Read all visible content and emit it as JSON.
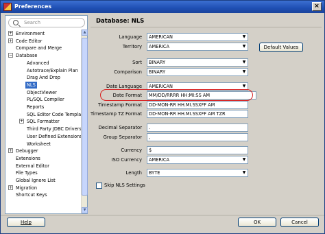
{
  "window": {
    "title": "Preferences",
    "close_glyph": "×"
  },
  "search": {
    "placeholder": "Search"
  },
  "tree": [
    {
      "label": "Environment",
      "toggle": "+",
      "level": 0
    },
    {
      "label": "Code Editor",
      "toggle": "+",
      "level": 0
    },
    {
      "label": "Compare and Merge",
      "toggle": "",
      "level": 0
    },
    {
      "label": "Database",
      "toggle": "−",
      "level": 0
    },
    {
      "label": "Advanced",
      "toggle": "",
      "level": 1
    },
    {
      "label": "Autotrace/Explain Plan",
      "toggle": "",
      "level": 1
    },
    {
      "label": "Drag And Drop",
      "toggle": "",
      "level": 1
    },
    {
      "label": "NLS",
      "toggle": "",
      "level": 1,
      "selected": true
    },
    {
      "label": "ObjectViewer",
      "toggle": "",
      "level": 1
    },
    {
      "label": "PL/SQL Compiler",
      "toggle": "",
      "level": 1
    },
    {
      "label": "Reports",
      "toggle": "",
      "level": 1
    },
    {
      "label": "SQL Editor Code Templates",
      "toggle": "",
      "level": 1
    },
    {
      "label": "SQL Formatter",
      "toggle": "+",
      "level": 1
    },
    {
      "label": "Third Party JDBC Drivers",
      "toggle": "",
      "level": 1
    },
    {
      "label": "User Defined Extensions",
      "toggle": "",
      "level": 1
    },
    {
      "label": "Worksheet",
      "toggle": "",
      "level": 1
    },
    {
      "label": "Debugger",
      "toggle": "+",
      "level": 0
    },
    {
      "label": "Extensions",
      "toggle": "",
      "level": 0
    },
    {
      "label": "External Editor",
      "toggle": "",
      "level": 0
    },
    {
      "label": "File Types",
      "toggle": "",
      "level": 0
    },
    {
      "label": "Global Ignore List",
      "toggle": "",
      "level": 0
    },
    {
      "label": "Migration",
      "toggle": "+",
      "level": 0
    },
    {
      "label": "Shortcut Keys",
      "toggle": "",
      "level": 0
    }
  ],
  "panel": {
    "heading": "Database: NLS",
    "fields": {
      "language": {
        "label": "Language",
        "value": "AMERICAN"
      },
      "territory": {
        "label": "Territory",
        "value": "AMERICA"
      },
      "sort": {
        "label": "Sort",
        "value": "BINARY"
      },
      "comparison": {
        "label": "Comparison",
        "value": "BINARY"
      },
      "date_language": {
        "label": "Date Language",
        "value": "AMERICAN"
      },
      "date_format": {
        "label": "Date Format",
        "value": "MM/DD/RRRR HH:MI:SS AM"
      },
      "timestamp_format": {
        "label": "Timestamp Format",
        "value": "DD-MON-RR HH.MI.SSXFF AM"
      },
      "timestamp_tz_format": {
        "label": "Timestamp TZ Format",
        "value": "DD-MON-RR HH.MI.SSXFF AM TZR"
      },
      "decimal_separator": {
        "label": "Decimal Separator",
        "value": "."
      },
      "group_separator": {
        "label": "Group Separator",
        "value": ","
      },
      "currency": {
        "label": "Currency",
        "value": "$"
      },
      "iso_currency": {
        "label": "ISO Currency",
        "value": "AMERICA"
      },
      "length": {
        "label": "Length",
        "value": "BYTE"
      }
    },
    "default_values_button": "Default Values",
    "skip_nls_label": "Skip NLS Settings",
    "highlight_color": "#d82020"
  },
  "footer": {
    "help": "Help",
    "ok": "OK",
    "cancel": "Cancel"
  },
  "colors": {
    "title_bar": "#1f4fb3",
    "selection": "#316ac5"
  }
}
